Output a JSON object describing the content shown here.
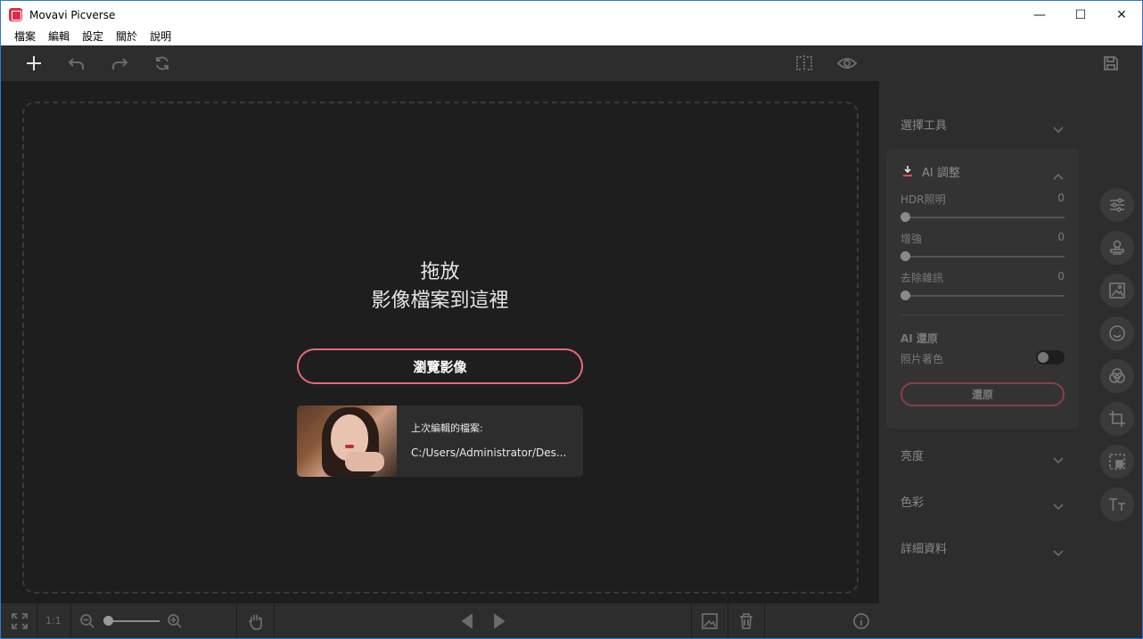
{
  "window": {
    "title": "Movavi Picverse",
    "minimize": "—",
    "maximize": "☐",
    "close": "✕"
  },
  "menu": [
    "檔案",
    "編輯",
    "設定",
    "關於",
    "說明"
  ],
  "dropzone": {
    "line1": "拖放",
    "line2": "影像檔案到這裡",
    "browse_label": "瀏覽影像"
  },
  "recent": {
    "label": "上次編輯的檔案:",
    "path": "C:/Users/Administrator/Des..."
  },
  "bottombar": {
    "ratio": "1:1"
  },
  "panel": {
    "select_tools": "選擇工具",
    "ai_adjust": "AI 調整",
    "sliders": [
      {
        "label": "HDR照明",
        "value": "0"
      },
      {
        "label": "增強",
        "value": "0"
      },
      {
        "label": "去除雜訊",
        "value": "0"
      }
    ],
    "ai_restore": "AI 還原",
    "colorize": "照片著色",
    "restore_button": "還原",
    "brightness": "亮度",
    "color": "色彩",
    "details": "詳細資料"
  },
  "icons": [
    "plus-icon",
    "undo-icon",
    "redo-icon",
    "reset-icon",
    "compare-icon",
    "eye-icon",
    "save-icon"
  ],
  "colors": {
    "accent": "#e86a79",
    "titlebar_border": "#2b7ad6",
    "panel_bg": "#2d2d2d",
    "canvas_bg": "#1e1e1e"
  }
}
